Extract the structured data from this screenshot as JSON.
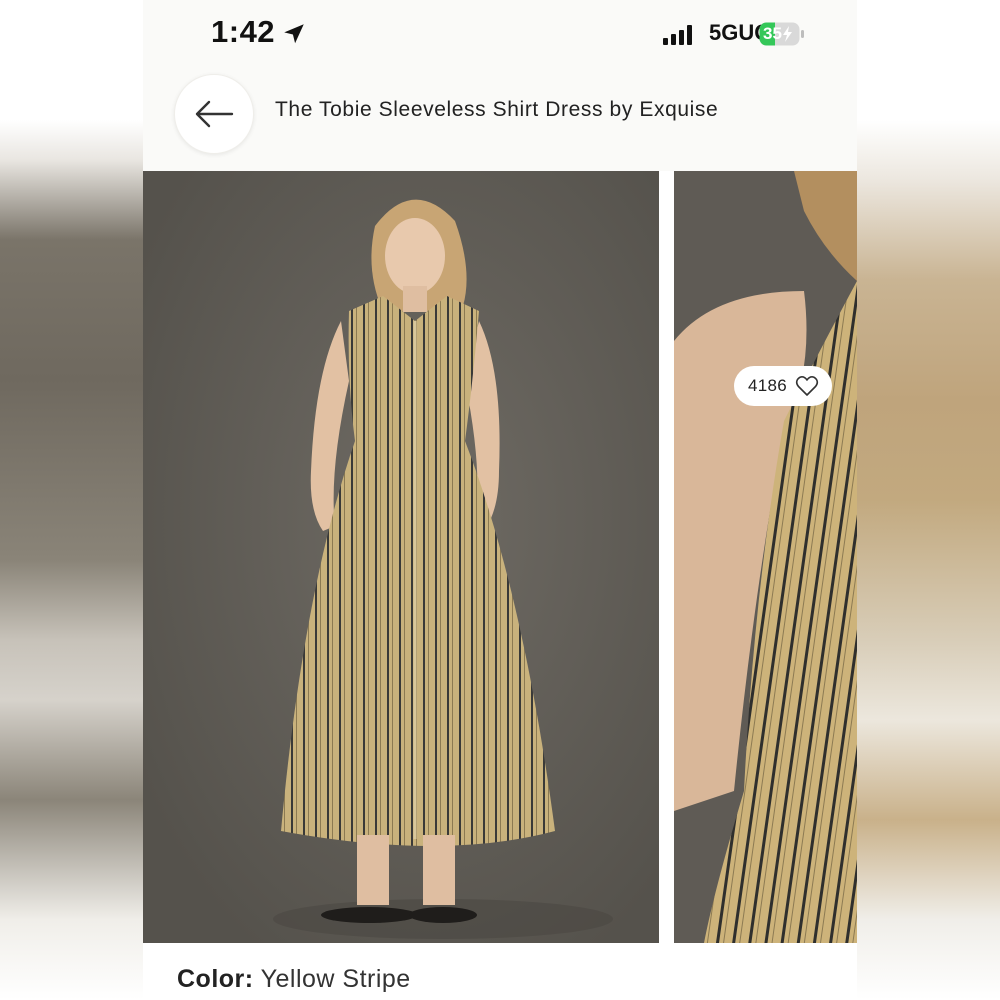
{
  "status_bar": {
    "time": "1:42",
    "network": "5GUC",
    "battery": "35"
  },
  "header": {
    "title": "The Tobie Sleeveless Shirt Dress by Exquise",
    "back_icon": "arrow-left-icon"
  },
  "gallery": {
    "like_count": "4186",
    "like_icon": "heart-icon"
  },
  "product": {
    "color_key": "Color:",
    "color_value": "Yellow Stripe"
  },
  "colors": {
    "dress": "#c9b27c",
    "stripe": "#3a3a38",
    "backdrop": "#64605a",
    "battery_green": "#34c759"
  }
}
